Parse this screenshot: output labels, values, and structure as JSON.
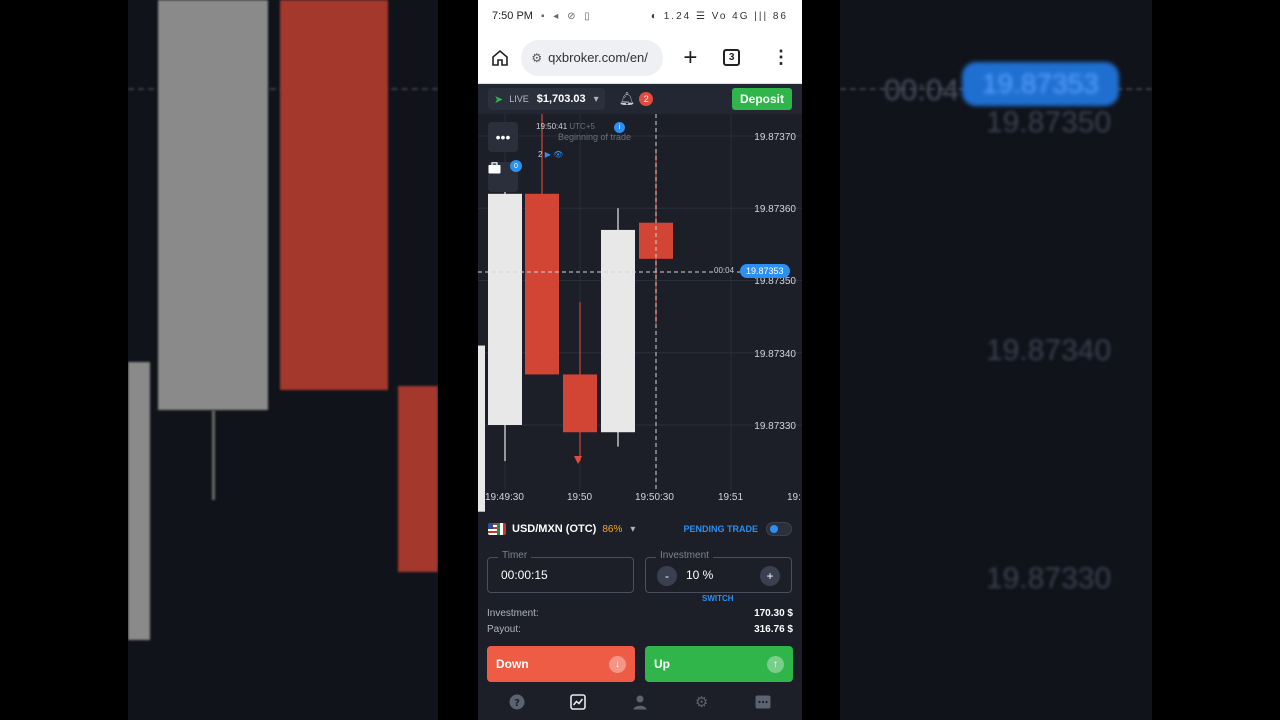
{
  "status_bar": {
    "time": "7:50 PM",
    "left_icons": "▪ ◂ ⊘ ▯",
    "right_icons": "◐ 1.24 ☰ Vo 4G ||| 86"
  },
  "browser": {
    "url": "qxbroker.com/en/",
    "tabs_count": "3"
  },
  "account": {
    "mode": "LIVE",
    "balance": "$1,703.03",
    "notifications": "2",
    "deposit_label": "Deposit"
  },
  "chart": {
    "y_labels": [
      "19.87370",
      "19.87360",
      "19.87350",
      "19.87340",
      "19.87330"
    ],
    "x_labels": [
      "19:49:30",
      "19:50",
      "19:50:30",
      "19:51",
      "19:"
    ],
    "current_price": "19.87353",
    "countdown": "00:04",
    "trade_time": "19:50:41",
    "trade_tz": "UTC+5",
    "trade_note": "Beginning of trade",
    "trade_count": "2",
    "portfolio_badge": "0",
    "more_label": "•••"
  },
  "chart_data": {
    "type": "candlestick",
    "candles": [
      {
        "time": "19:49:30",
        "open": 19.8733,
        "close": 19.87362,
        "low": 19.87325,
        "high": 19.87366,
        "color": "white"
      },
      {
        "time": "19:49:45",
        "open": 19.87362,
        "close": 19.87337,
        "low": 19.87337,
        "high": 19.87375,
        "color": "red"
      },
      {
        "time": "19:50",
        "open": 19.87337,
        "close": 19.87329,
        "low": 19.87325,
        "high": 19.87347,
        "color": "red"
      },
      {
        "time": "19:50:15",
        "open": 19.87329,
        "close": 19.87357,
        "low": 19.87327,
        "high": 19.8736,
        "color": "white"
      },
      {
        "time": "19:50:30",
        "open": 19.87358,
        "close": 19.87353,
        "low": 19.87344,
        "high": 19.87368,
        "color": "red"
      }
    ],
    "ylim": [
      19.8732,
      19.87375
    ]
  },
  "asset": {
    "name": "USD/MXN (OTC)",
    "payout_percent": "86%",
    "pending_label": "PENDING TRADE"
  },
  "form": {
    "timer_label": "Timer",
    "timer_value": "00:00:15",
    "investment_label": "Investment",
    "investment_value": "10 %",
    "switch_label": "SWITCH",
    "minus": "-",
    "plus": "+"
  },
  "summary": {
    "investment_key": "Investment:",
    "investment_val": "170.30 $",
    "payout_key": "Payout:",
    "payout_val": "316.76 $"
  },
  "buttons": {
    "down": "Down",
    "up": "Up"
  },
  "side_backgrounds": {
    "left_countdown": "00:04",
    "right_price_tag": "19.87353",
    "right_labels": [
      "19.87350",
      "19.87340",
      "19.87330"
    ]
  },
  "colors": {
    "red": "#ef5c45",
    "green": "#2fb54a",
    "blue": "#2c8ff2",
    "bg": "#1c1f28"
  }
}
